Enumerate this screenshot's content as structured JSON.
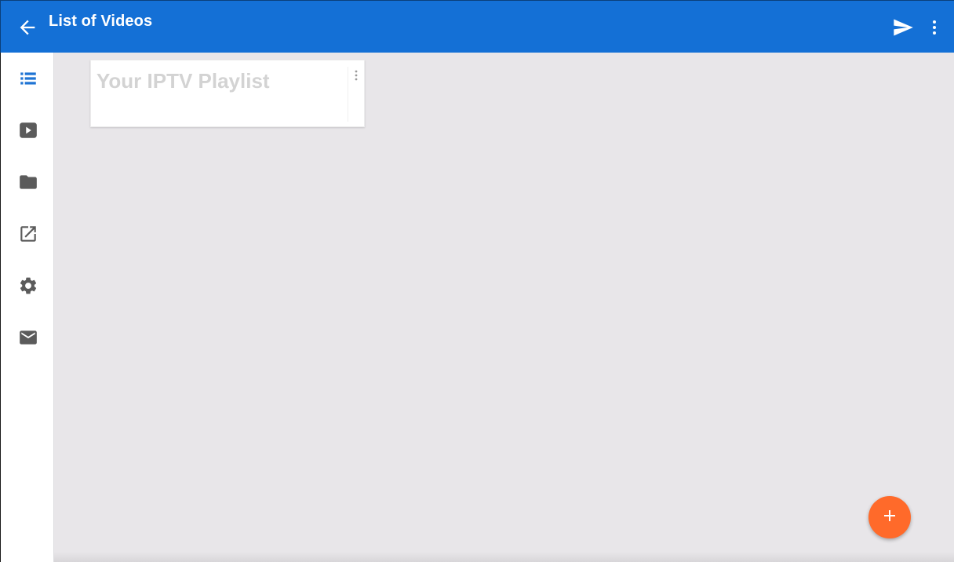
{
  "appbar": {
    "title": "List of Videos",
    "back_icon": "arrow-back-icon",
    "send_icon": "send-icon",
    "more_icon": "more-vert-icon",
    "color": "#1470d6"
  },
  "sidebar": {
    "items": [
      {
        "icon": "list-icon",
        "active": true
      },
      {
        "icon": "play-video-icon",
        "active": false
      },
      {
        "icon": "folder-icon",
        "active": false
      },
      {
        "icon": "open-external-icon",
        "active": false
      },
      {
        "icon": "gear-icon",
        "active": false
      },
      {
        "icon": "mail-icon",
        "active": false
      }
    ],
    "active_color": "#1f74d4",
    "icon_color": "#5b5b5b"
  },
  "playlist_card": {
    "title": "Your IPTV Playlist",
    "menu_icon": "more-vert-icon"
  },
  "fab": {
    "icon": "plus-icon",
    "color": "#ff6a2a"
  }
}
